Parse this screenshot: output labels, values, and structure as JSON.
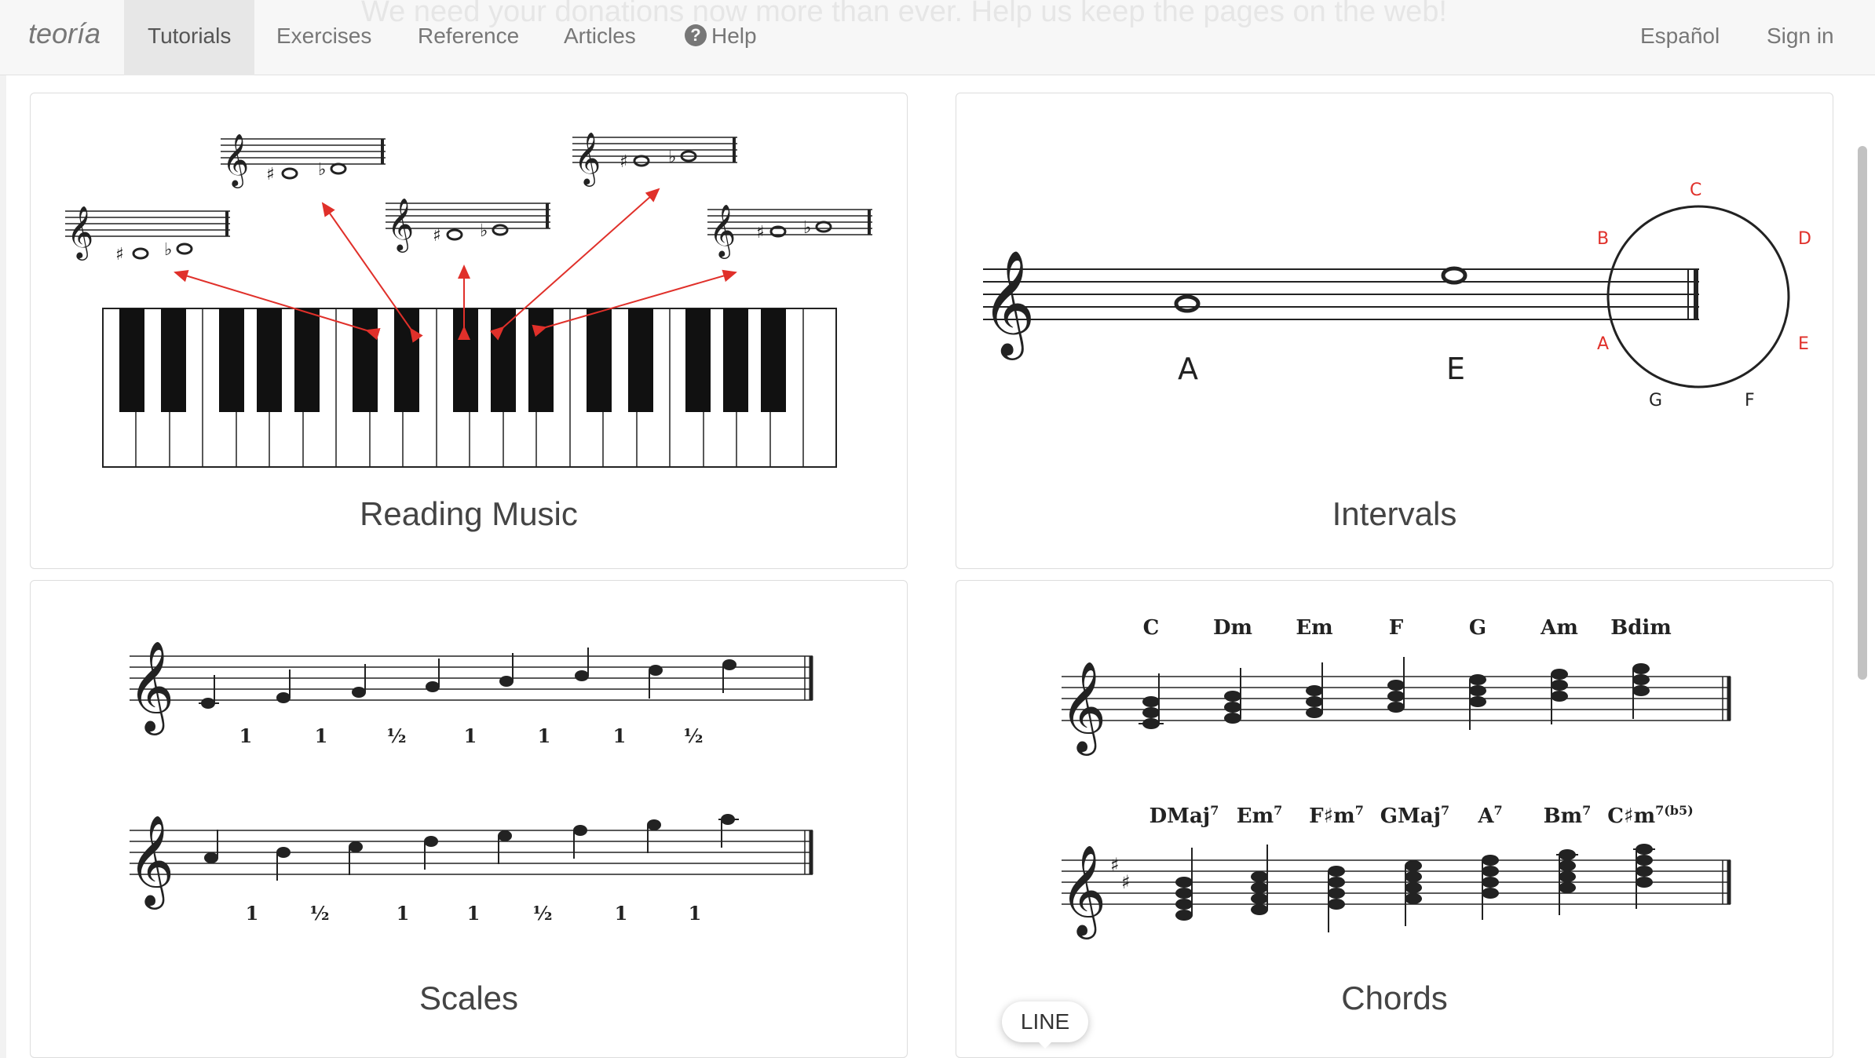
{
  "nav": {
    "banner": "We need your donations now more than ever. Help us keep the pages on the web!",
    "brand": "teoría",
    "items": [
      {
        "label": "Tutorials"
      },
      {
        "label": "Exercises"
      },
      {
        "label": "Reference"
      },
      {
        "label": "Articles"
      },
      {
        "label": "Help"
      }
    ],
    "language": "Español",
    "signin": "Sign in",
    "help_icon": "question-circle-icon"
  },
  "cards": [
    {
      "title": "Reading Music"
    },
    {
      "title": "Intervals"
    },
    {
      "title": "Scales"
    },
    {
      "title": "Chords"
    }
  ],
  "intervals": {
    "notes": [
      "A",
      "E"
    ],
    "circle": [
      "C",
      "D",
      "E",
      "F",
      "G",
      "A",
      "B"
    ]
  },
  "scales": {
    "row1": [
      "1",
      "1",
      "½",
      "1",
      "1",
      "1",
      "½"
    ],
    "row2": [
      "1",
      "½",
      "1",
      "1",
      "½",
      "1",
      "1"
    ]
  },
  "chords": {
    "row1": [
      "C",
      "Dm",
      "Em",
      "F",
      "G",
      "Am",
      "Bdim"
    ],
    "row2": [
      {
        "base": "DMaj",
        "sup": "7"
      },
      {
        "base": "Em",
        "sup": "7"
      },
      {
        "base": "F♯m",
        "sup": "7"
      },
      {
        "base": "GMaj",
        "sup": "7"
      },
      {
        "base": "A",
        "sup": "7"
      },
      {
        "base": "Bm",
        "sup": "7"
      },
      {
        "base": "C♯m",
        "sup": "7(b5)"
      }
    ]
  },
  "tooltip": "LINE",
  "colors": {
    "accent": "#e0302a",
    "nav_bg": "#f7f7f7"
  }
}
